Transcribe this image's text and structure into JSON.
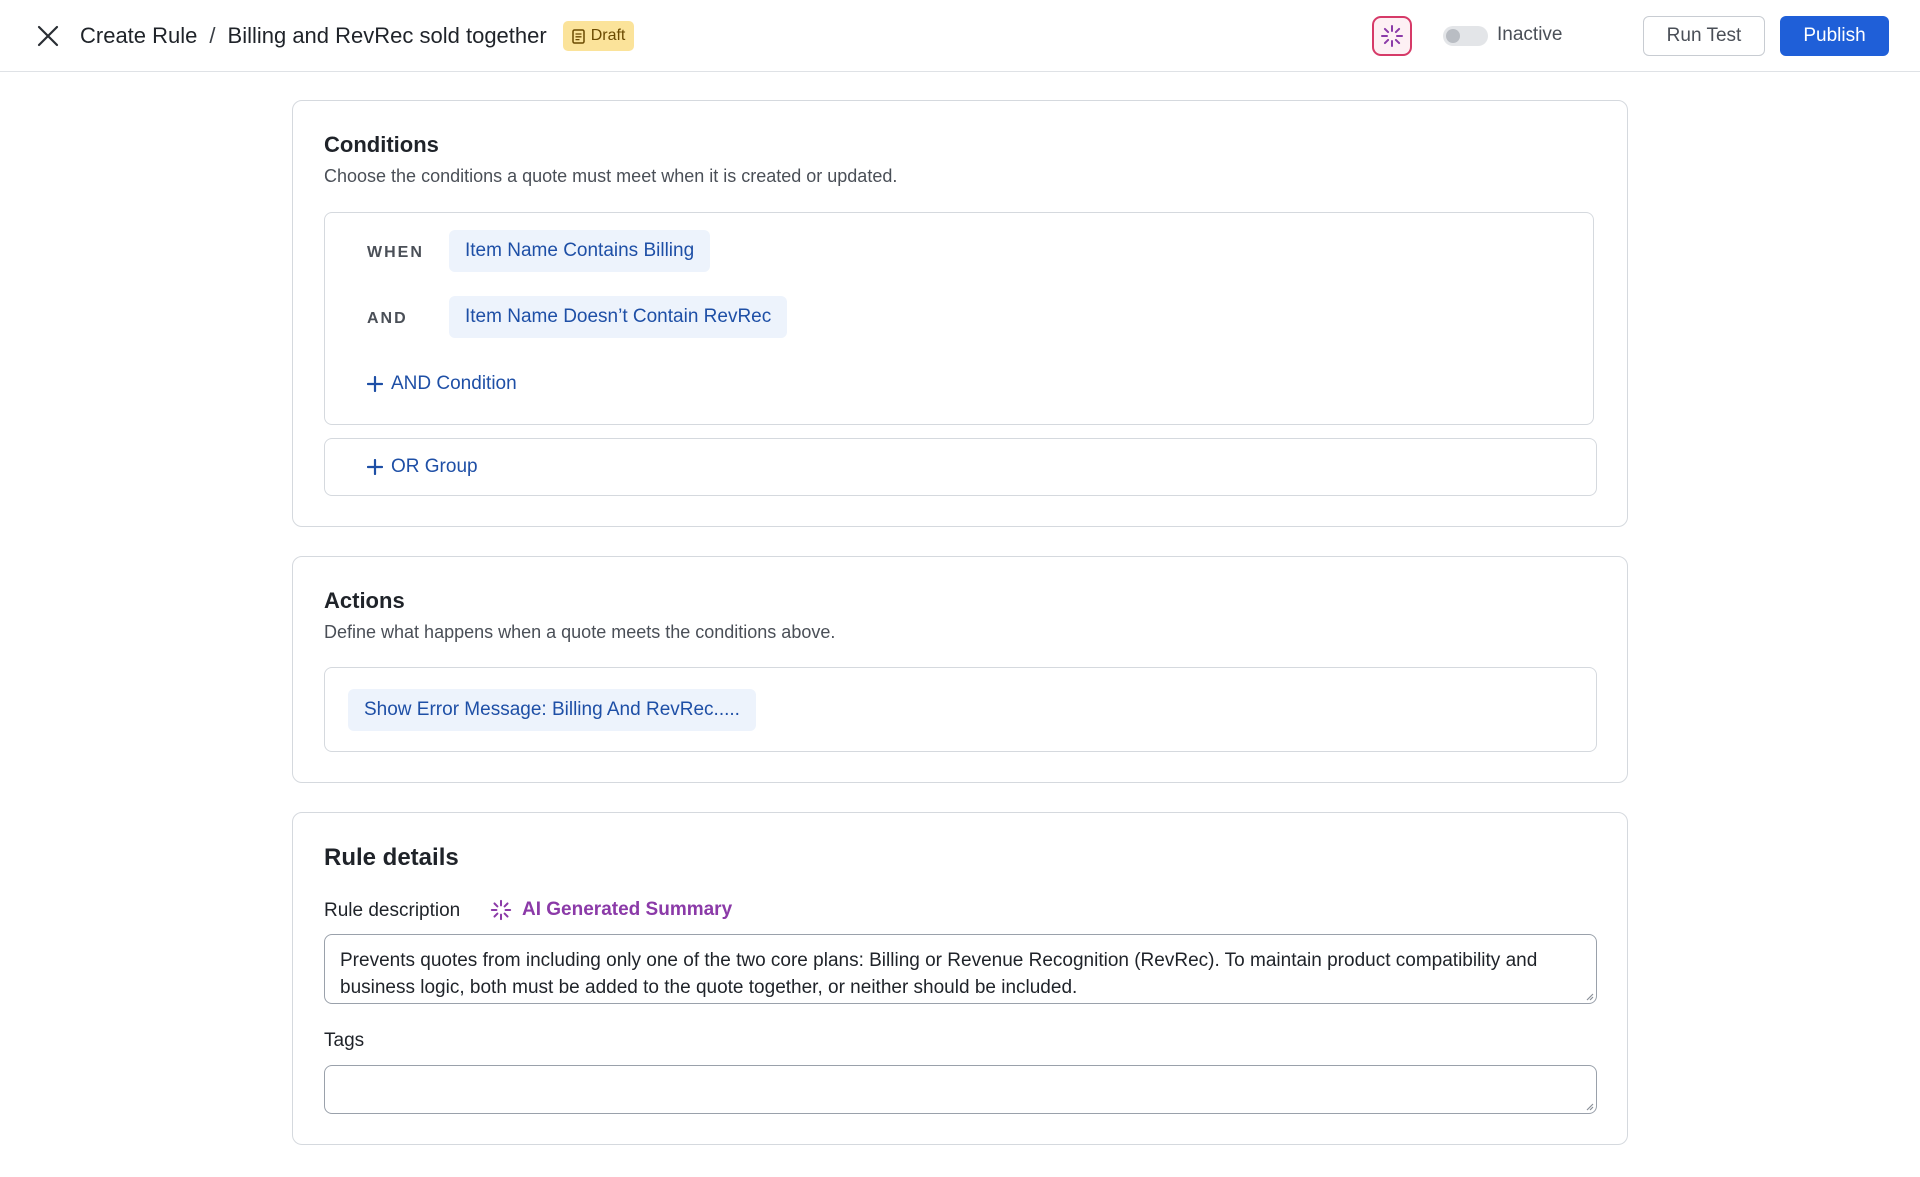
{
  "header": {
    "breadcrumb_root": "Create Rule",
    "breadcrumb_separator": "/",
    "rule_name": "Billing and RevRec sold together",
    "status_badge": "Draft",
    "toggle_label": "Inactive",
    "toggle_on": false,
    "run_test_label": "Run Test",
    "publish_label": "Publish",
    "icons": {
      "close": "close-icon",
      "draft": "document-icon",
      "ai": "sparkle-icon"
    }
  },
  "conditions": {
    "title": "Conditions",
    "subtitle": "Choose the conditions a quote must meet when it is created or updated.",
    "rows": [
      {
        "keyword": "WHEN",
        "value": "Item Name Contains Billing"
      },
      {
        "keyword": "AND",
        "value": "Item Name Doesn’t Contain RevRec"
      }
    ],
    "add_and_label": "AND Condition",
    "add_or_label": "OR Group"
  },
  "actions": {
    "title": "Actions",
    "subtitle": "Define what happens when a quote meets the conditions above.",
    "items": [
      {
        "value": "Show Error Message: Billing And RevRec....."
      }
    ]
  },
  "rule_details": {
    "title": "Rule details",
    "description_label": "Rule description",
    "ai_summary_label": "AI Generated Summary",
    "description_value": "Prevents quotes from including only one of the two core plans: Billing or Revenue Recognition (RevRec). To maintain product compatibility and business logic, both must be added to the quote together, or neither should be included.",
    "tags_label": "Tags",
    "tags_value": ""
  },
  "colors": {
    "primary": "#1f5fd8",
    "pill_bg": "#edf3fc",
    "pill_text": "#1e4fa6",
    "draft_bg": "#fbe39a",
    "ai_accent": "#8b3aa8",
    "ai_border": "#d63a68"
  }
}
